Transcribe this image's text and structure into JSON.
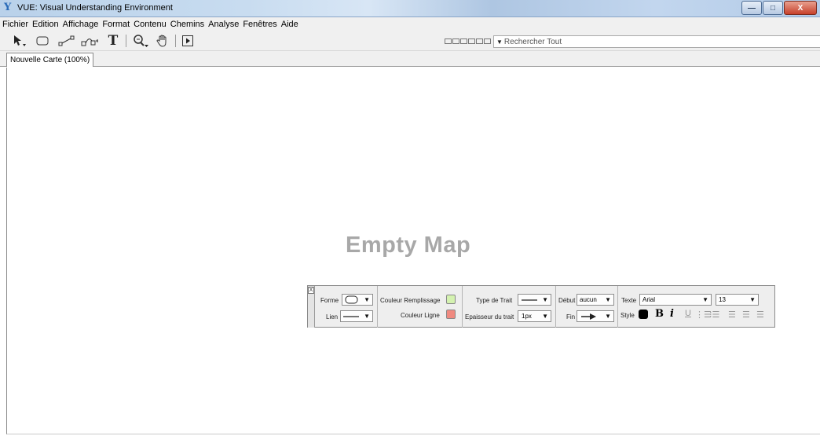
{
  "window": {
    "title": "VUE: Visual Understanding Environment",
    "buttons": {
      "minimize": "—",
      "maximize": "□",
      "close": "X"
    }
  },
  "menu": [
    "Fichier",
    "Edition",
    "Affichage",
    "Format",
    "Contenu",
    "Chemins",
    "Analyse",
    "Fenêtres",
    "Aide"
  ],
  "toolbar": {
    "tools": [
      "selection-tool",
      "node-tool",
      "link-tool",
      "curved-link-tool",
      "text-tool",
      "zoom-tool",
      "hand-tool",
      "presentation-tool"
    ],
    "text_tool_glyph": "T",
    "search_placeholder": "Rechercher Tout"
  },
  "tabs": [
    {
      "label": "Nouvelle Carte (100%)"
    }
  ],
  "canvas": {
    "empty_text": "Empty Map"
  },
  "palette": {
    "close_label": "X",
    "forme_label": "Forme",
    "lien_label": "Lien",
    "couleur_remplissage_label": "Couleur Remplissage",
    "couleur_ligne_label": "Couleur Ligne",
    "type_trait_label": "Type de Trait",
    "epaisseur_label": "Epaisseur du trait",
    "epaisseur_value": "1px",
    "debut_label": "Début",
    "debut_value": "aucun",
    "fin_label": "Fin",
    "texte_label": "Texte",
    "font_value": "Arial",
    "size_value": "13",
    "style_label": "Style",
    "bold_glyph": "B",
    "italic_glyph": "i",
    "underline_glyph": "U",
    "fill_color": "#d4f2b0",
    "line_color": "#f08a80",
    "text_color": "#000000"
  }
}
